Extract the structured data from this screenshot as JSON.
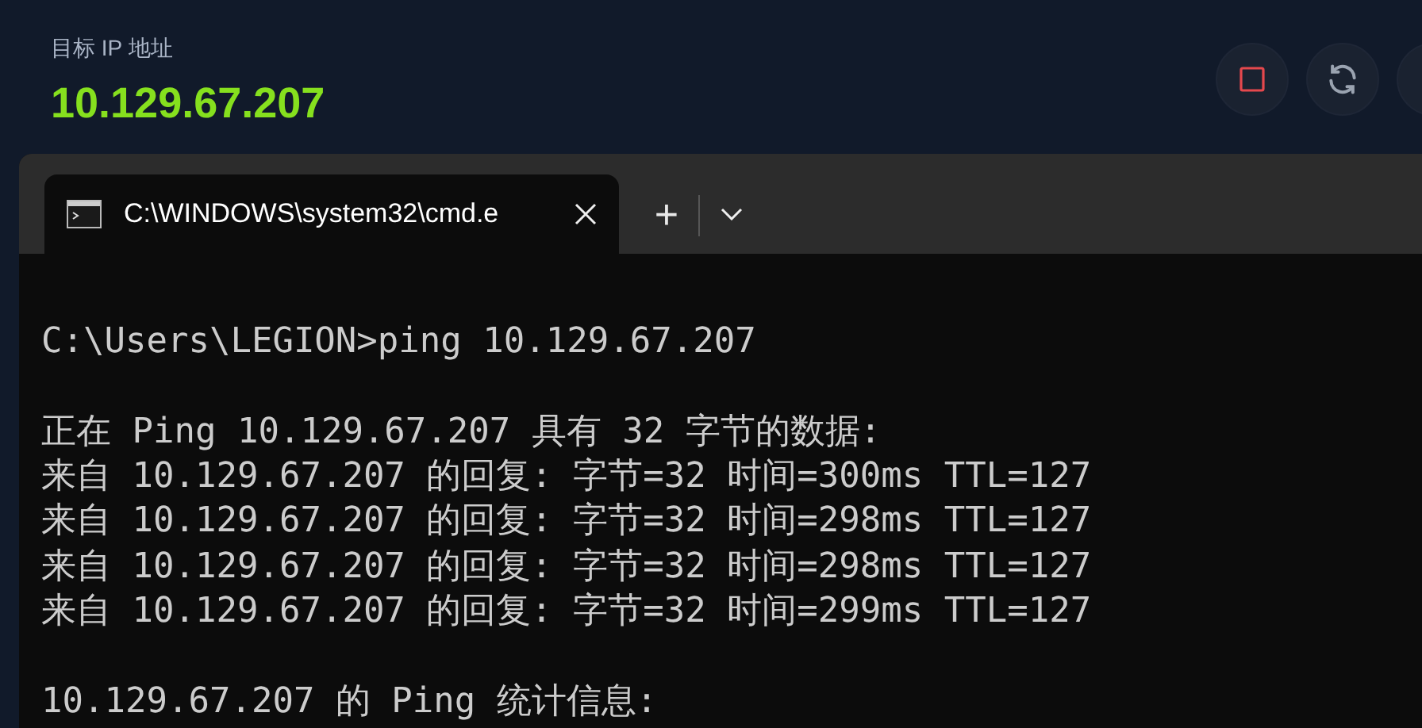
{
  "header": {
    "label": "目标 IP 地址",
    "ip": "10.129.67.207"
  },
  "terminal": {
    "tab_title": "C:\\WINDOWS\\system32\\cmd.e",
    "new_tab": "+",
    "blocks": [
      [
        "C:\\Users\\LEGION>ping 10.129.67.207"
      ],
      [
        "正在 Ping 10.129.67.207 具有 32 字节的数据:",
        "来自 10.129.67.207 的回复: 字节=32 时间=300ms TTL=127",
        "来自 10.129.67.207 的回复: 字节=32 时间=298ms TTL=127",
        "来自 10.129.67.207 的回复: 字节=32 时间=298ms TTL=127",
        "来自 10.129.67.207 的回复: 字节=32 时间=299ms TTL=127"
      ],
      [
        "10.129.67.207 的 Ping 统计信息:"
      ]
    ]
  }
}
